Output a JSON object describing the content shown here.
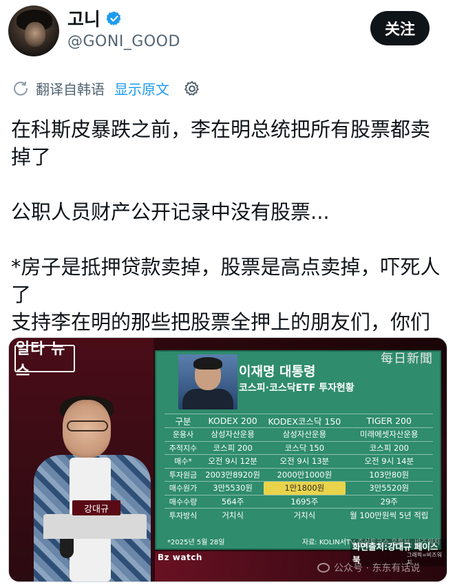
{
  "author": {
    "display_name": "고니",
    "handle": "@GONI_GOOD",
    "verified": true,
    "follow_label": "关注"
  },
  "translation": {
    "translated_from": "翻译自韩语",
    "show_original": "显示原文"
  },
  "tweet": {
    "paragraphs": [
      "在科斯皮暴跌之前，李在明总统把所有股票都卖掉了",
      "公职人员财产公开记录中没有股票...",
      "*房子是抵押贷款卖掉，股票是高点卖掉，吓死人了\n支持李在明的那些把股票全押上的朋友们，你们还好吗"
    ]
  },
  "media": {
    "show_logo": "일타 뉴스",
    "name_card": "강대규",
    "newspaper_mark": "每日新聞",
    "board": {
      "title": "이재명 대통령",
      "subtitle": "코스피·코스닥ETF 투자현황",
      "columns": [
        "구분",
        "KODEX 200",
        "KODEX코스닥 150",
        "TIGER 200"
      ],
      "rows": [
        [
          "운용사",
          "삼성자산운용",
          "삼성자산운용",
          "미래에셋자산운용"
        ],
        [
          "추적지수",
          "코스피 200",
          "코스닥 150",
          "코스피 200"
        ],
        [
          "매수*",
          "오전 9시 12분",
          "오전 9시 13분",
          "오전 9시 14분"
        ],
        [
          "투자원금",
          "2003만8920원",
          "2000만1000원",
          "103만80원"
        ],
        [
          "매수원가",
          "3만5530원",
          "1만1800원",
          "3만5520원"
        ],
        [
          "매수수량",
          "564주",
          "1695주",
          "29주"
        ],
        [
          "투자방식",
          "거치식",
          "거치식",
          "월 100만원씩 5년 적립"
        ]
      ],
      "footnote_left": "*2025년 5월 28일",
      "footnote_right": "자료: KOLIN서TV 주식토크쇼 유튜브, 비즈워치"
    },
    "bz_watch": "Bz watch",
    "source_caption": "화면출처:강대규 페이스북",
    "source_sub": "그래픽=비즈워치",
    "wechat_mark": "公众号 · 东东有话说"
  },
  "colors": {
    "follow_bg": "#0f1419",
    "link": "#1d9bf0",
    "secondary_text": "#536471",
    "board_green": "#2f8c6d",
    "highlight": "#e9d34a"
  }
}
